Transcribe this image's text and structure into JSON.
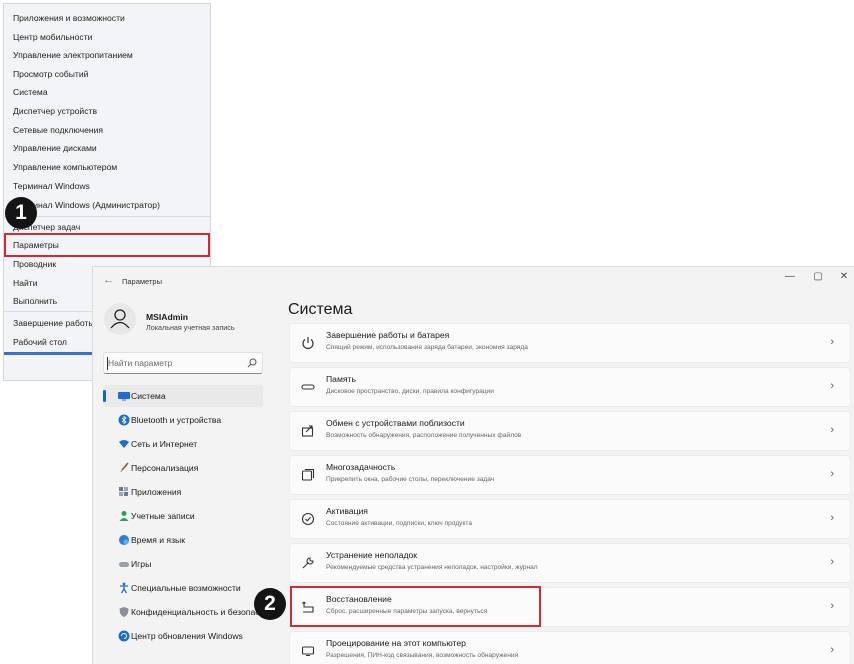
{
  "winx_menu": {
    "items": [
      "Приложения и возможности",
      "Центр мобильности",
      "Управление электропитанием",
      "Просмотр событий",
      "Система",
      "Диспетчер устройств",
      "Сетевые подключения",
      "Управление дисками",
      "Управление компьютером",
      "Терминал Windows",
      "Терминал Windows (Администратор)",
      "Диспетчер задач",
      "Параметры",
      "Проводник",
      "Найти",
      "Выполнить",
      "Завершение работы или выход из системы",
      "Рабочий стол"
    ],
    "highlighted_item": "Параметры"
  },
  "settings_window": {
    "title": "Параметры",
    "controls": {
      "minimize": "—",
      "maximize": "▢",
      "close": "✕"
    },
    "profile": {
      "name": "MSIAdmin",
      "account_type": "Локальная учетная запись"
    },
    "search_placeholder": "Найти параметр",
    "nav": [
      {
        "label": "Система",
        "icon": "monitor-icon",
        "active": true
      },
      {
        "label": "Bluetooth и устройства",
        "icon": "bluetooth-icon"
      },
      {
        "label": "Сеть и Интернет",
        "icon": "wifi-icon"
      },
      {
        "label": "Персонализация",
        "icon": "brush-icon"
      },
      {
        "label": "Приложения",
        "icon": "apps-icon"
      },
      {
        "label": "Учетные записи",
        "icon": "person-icon"
      },
      {
        "label": "Время и язык",
        "icon": "globe-clock-icon"
      },
      {
        "label": "Игры",
        "icon": "gamepad-icon"
      },
      {
        "label": "Специальные возможности",
        "icon": "accessibility-icon"
      },
      {
        "label": "Конфиденциальность и безопасность",
        "icon": "shield-icon"
      },
      {
        "label": "Центр обновления Windows",
        "icon": "update-icon"
      }
    ],
    "page_title": "Система",
    "cards": [
      {
        "title": "Завершение работы и батарея",
        "subtitle": "Спящий режим, использование заряда батареи, экономия заряда",
        "icon": "power-icon"
      },
      {
        "title": "Память",
        "subtitle": "Дисковое пространство, диски, правила конфигурации",
        "icon": "storage-icon"
      },
      {
        "title": "Обмен с устройствами поблизости",
        "subtitle": "Возможность обнаружения, расположение полученных файлов",
        "icon": "share-icon"
      },
      {
        "title": "Многозадачность",
        "subtitle": "Прикрепить окна, рабочие столы, переключение задач",
        "icon": "multitask-icon"
      },
      {
        "title": "Активация",
        "subtitle": "Состояние активации, подписки, ключ продукта",
        "icon": "check-circle-icon"
      },
      {
        "title": "Устранение неполадок",
        "subtitle": "Рекомендуемые средства устранения неполадок, настройки, журнал",
        "icon": "wrench-icon"
      },
      {
        "title": "Восстановление",
        "subtitle": "Сброс, расширенные параметры запуска, вернуться",
        "icon": "recovery-icon"
      },
      {
        "title": "Проецирование на этот компьютер",
        "subtitle": "Разрешения, ПИН-код связывания, возможность обнаружения",
        "icon": "project-icon"
      }
    ],
    "highlighted_card": "Восстановление"
  },
  "callouts": [
    "1",
    "2"
  ],
  "colors": {
    "accent": "#0a66c7",
    "highlight": "#d42a33",
    "badge": "#141414"
  }
}
